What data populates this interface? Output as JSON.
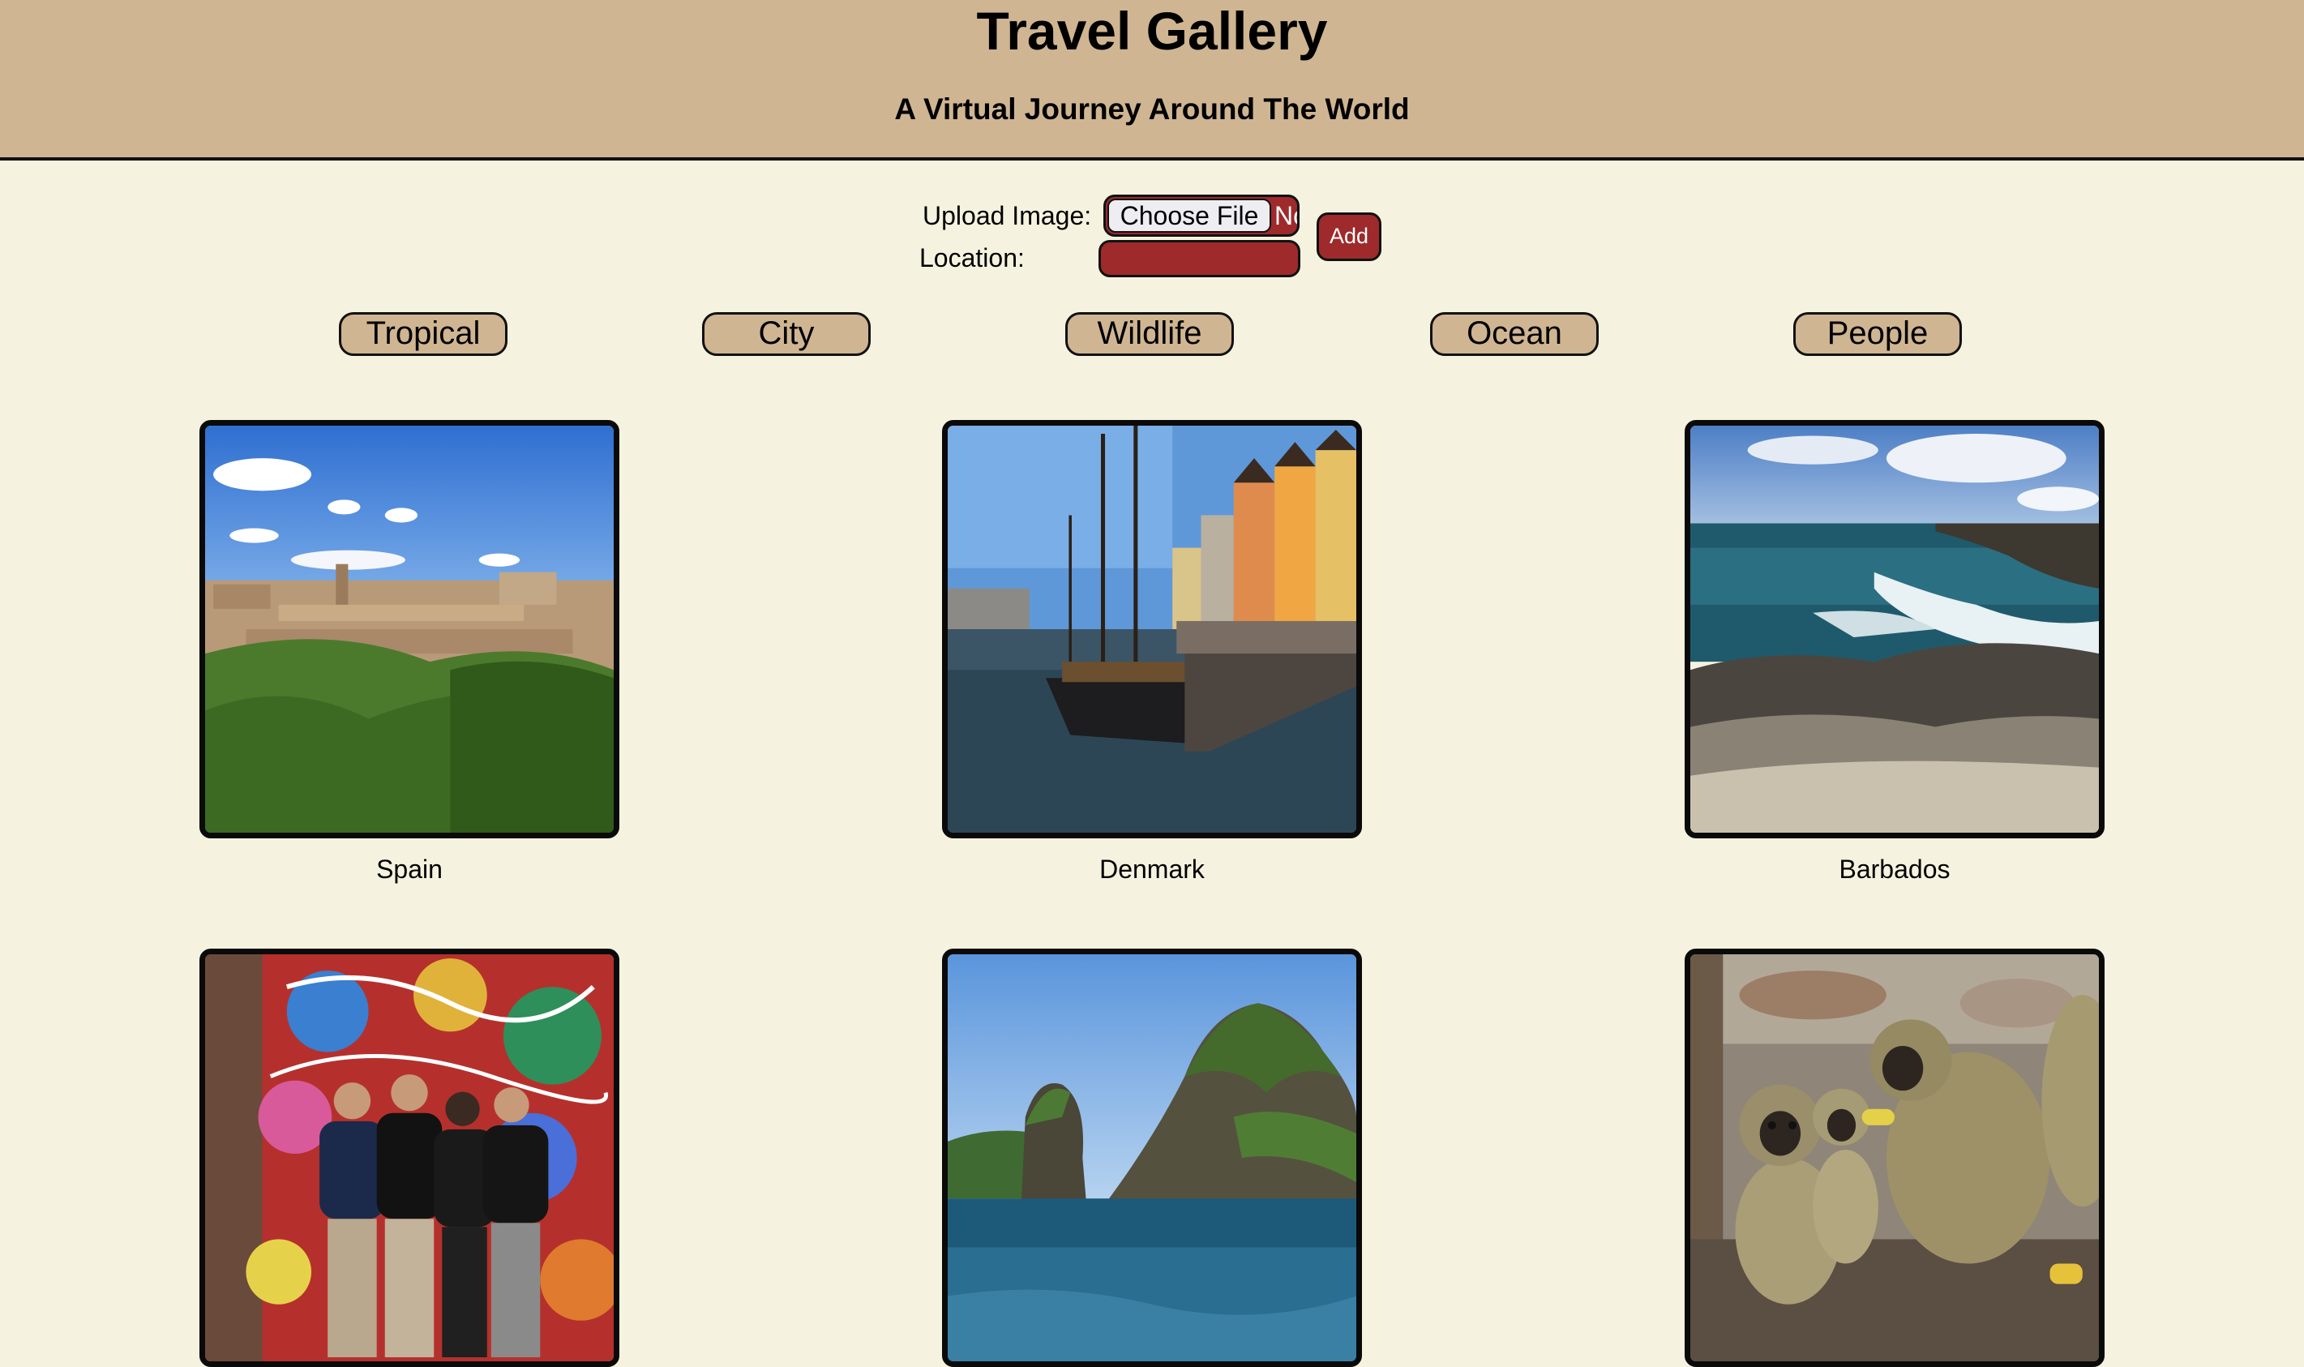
{
  "header": {
    "title": "Travel Gallery",
    "subtitle": "A Virtual Journey Around The World"
  },
  "upload": {
    "image_label": "Upload Image:",
    "choose_file_label": "Choose File",
    "no_file_text": "No file chosen",
    "location_label": "Location:",
    "location_value": "",
    "add_label": "Add"
  },
  "categories": [
    "Tropical",
    "City",
    "Wildlife",
    "Ocean",
    "People"
  ],
  "gallery": [
    {
      "caption": "Spain",
      "image": "toledo-cityscape-photo"
    },
    {
      "caption": "Denmark",
      "image": "nyhavn-harbor-photo"
    },
    {
      "caption": "Barbados",
      "image": "rocky-coastline-photo"
    },
    {
      "caption": "",
      "image": "graffiti-wall-group-photo"
    },
    {
      "caption": "",
      "image": "limestone-islands-photo"
    },
    {
      "caption": "",
      "image": "monkeys-photo"
    }
  ],
  "colors": {
    "page_background": "#f5f3df",
    "header_background": "#cfb592",
    "accent_red": "#9e2a2b",
    "border": "#111111"
  }
}
